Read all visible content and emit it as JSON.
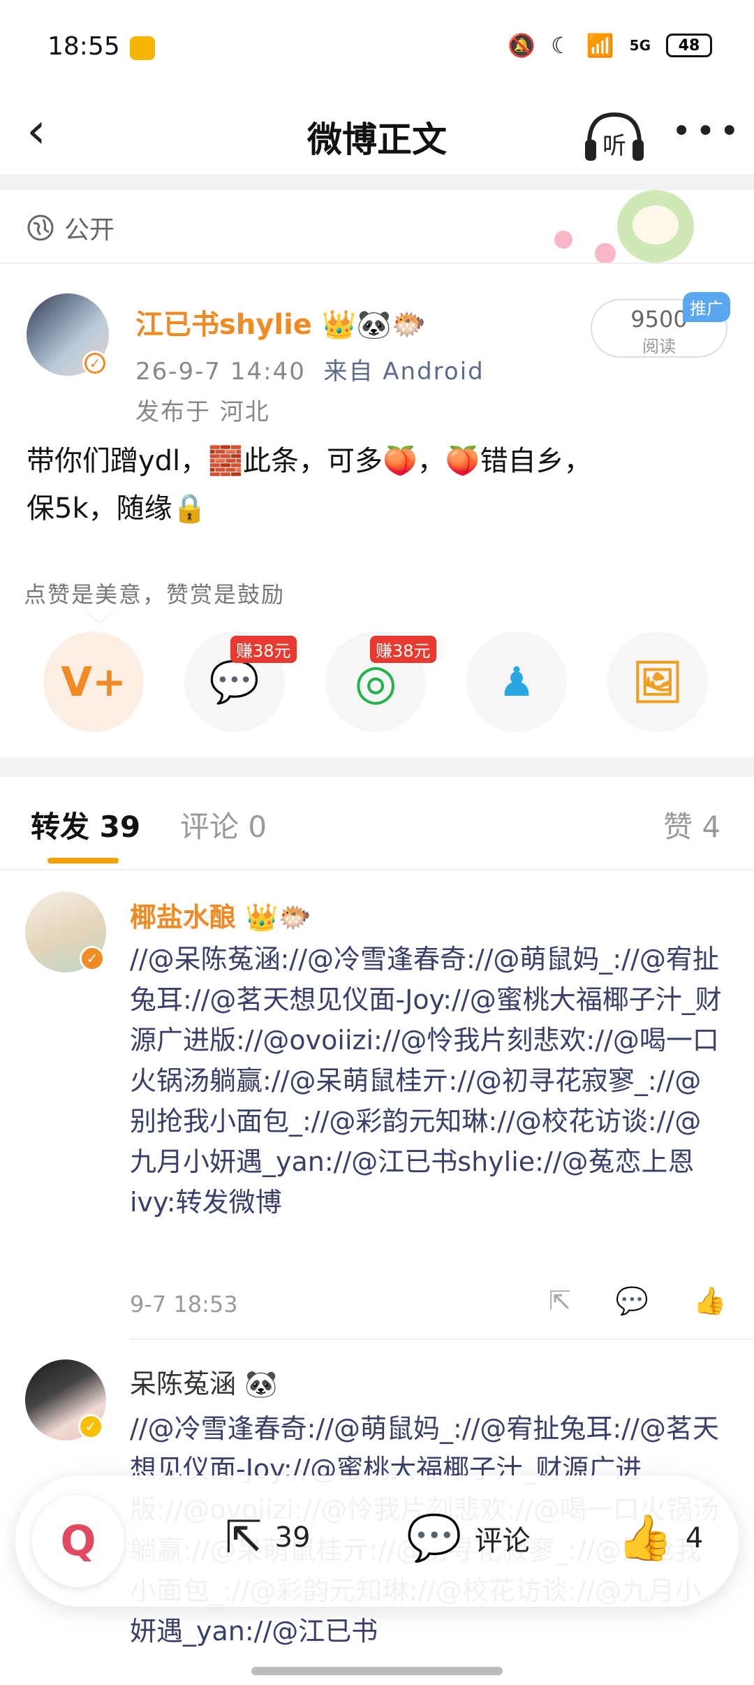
{
  "status_bar": {
    "time": "18:55",
    "network": "5G",
    "battery": "48"
  },
  "nav": {
    "title": "微博正文",
    "listen_label": "听",
    "more": "•••"
  },
  "visibility": "公开",
  "post": {
    "author": "江已书shylie",
    "author_badges": [
      "👑",
      "🐼",
      "🐡"
    ],
    "time": "26-9-7  14:40",
    "source": "来自 Android",
    "location": "发布于 河北",
    "reads_count": "9500",
    "reads_label": "阅读",
    "promo": "推广",
    "content_line1": "带你们蹭ydl，🧱此条，可多🍑，🍑错自乡，",
    "content_line2": "保5k，随缘🔒"
  },
  "reward_hint": "点赞是美意，赞赏是鼓励",
  "share_options": [
    {
      "name": "reward",
      "icon": "V+"
    },
    {
      "name": "wechat",
      "icon": "💬",
      "earn": "赚38元"
    },
    {
      "name": "moments",
      "icon": "◎",
      "earn": "赚38元"
    },
    {
      "name": "qq",
      "icon": "♟"
    },
    {
      "name": "save-image",
      "icon": "🖼"
    }
  ],
  "tabs": {
    "repost": "转发 39",
    "comment": "评论 0",
    "like": "赞 4"
  },
  "reposts": [
    {
      "user": "椰盐水酿",
      "badges": "👑🐡",
      "text": "//@呆陈菟涵://@冷雪逢春奇://@萌鼠妈_://@宥扯兔耳://@茗天想见仪面-Joy://@蜜桃大福椰子汁_财源广进版://@ovoiizi://@怜我片刻悲欢://@喝一口火锅汤躺赢://@呆萌鼠桂亓://@初寻花寂寥_://@别抢我小面包_://@彩韵元知琳://@校花访谈://@九月小妍遇_yan://@江已书shylie://@菟恋上恩ivy:转发微博",
      "time": "9-7  18:53"
    },
    {
      "user": "呆陈菟涵",
      "badges": "🐼",
      "text": "//@冷雪逢春奇://@萌鼠妈_://@宥扯兔耳://@茗天想见仪面-Joy://@蜜桃大福椰子汁_财源广进版://@ovoiizi://@怜我片刻悲欢://@喝一口火锅汤躺赢://@呆萌鼠桂亓://@初寻花寂寥_://@别抢我小面包_://@彩韵元知琳://@校花访谈://@九月小妍遇_yan://@江已书"
    }
  ],
  "bottom_bar": {
    "repost_count": "39",
    "comment_label": "评论",
    "like_count": "4"
  },
  "colors": {
    "accent": "#f08a24",
    "repost_text": "#3a3f6a",
    "tab_underline": "#f5a000",
    "earn_badge": "#e8392e"
  }
}
